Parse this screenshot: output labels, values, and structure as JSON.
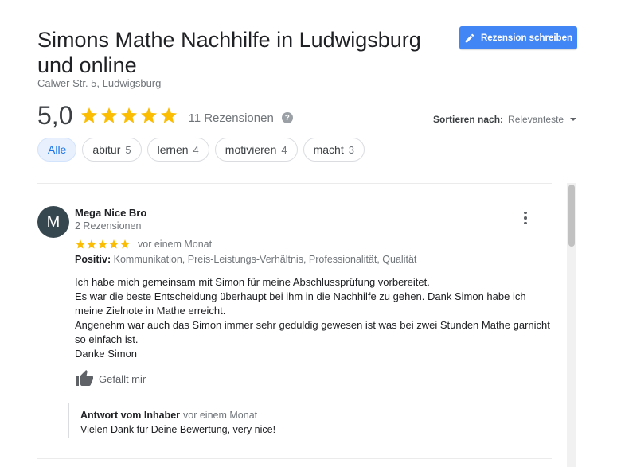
{
  "header": {
    "title": "Simons Mathe Nachhilfe in Ludwigsburg und online",
    "address": "Calwer Str. 5, Ludwigsburg",
    "write_review_label": "Rezension schreiben"
  },
  "summary": {
    "rating": "5,0",
    "rating_value": 5.0,
    "review_count": "11 Rezensionen",
    "help": "?"
  },
  "sort": {
    "label": "Sortieren nach:",
    "value": "Relevanteste"
  },
  "chips": [
    {
      "label": "Alle",
      "count": ""
    },
    {
      "label": "abitur",
      "count": "5"
    },
    {
      "label": "lernen",
      "count": "4"
    },
    {
      "label": "motivieren",
      "count": "4"
    },
    {
      "label": "macht",
      "count": "3"
    }
  ],
  "review": {
    "avatar_letter": "M",
    "name": "Mega Nice Bro",
    "meta": "2 Rezensionen",
    "stars": 5,
    "time": "vor einem Monat",
    "positive_label": "Positiv:",
    "positive_text": "Kommunikation, Preis-Leistungs-Verhältnis, Professionalität, Qualität",
    "text_lines": [
      "Ich habe mich gemeinsam mit Simon für meine Abschlussprüfung vorbereitet.",
      "Es war die beste Entscheidung überhaupt bei ihm in die Nachhilfe zu gehen. Dank Simon habe ich meine Zielnote in Mathe erreicht.",
      "Angenehm war auch das Simon immer sehr geduldig gewesen ist was bei zwei Stunden Mathe garnicht so einfach ist.",
      "Danke Simon"
    ],
    "like_label": "Gefällt mir",
    "reply": {
      "author": "Antwort vom Inhaber",
      "time": "vor einem Monat",
      "text": "Vielen Dank für Deine Bewertung, very nice!"
    }
  },
  "colors": {
    "accent": "#4285f4",
    "star": "#fbbc04",
    "chip_active_bg": "#e8f0fe",
    "avatar": "#37474f"
  },
  "icons": [
    "pencil-icon",
    "star-icon",
    "help-icon",
    "caret-down-icon",
    "more-vert-icon",
    "thumb-up-icon"
  ]
}
